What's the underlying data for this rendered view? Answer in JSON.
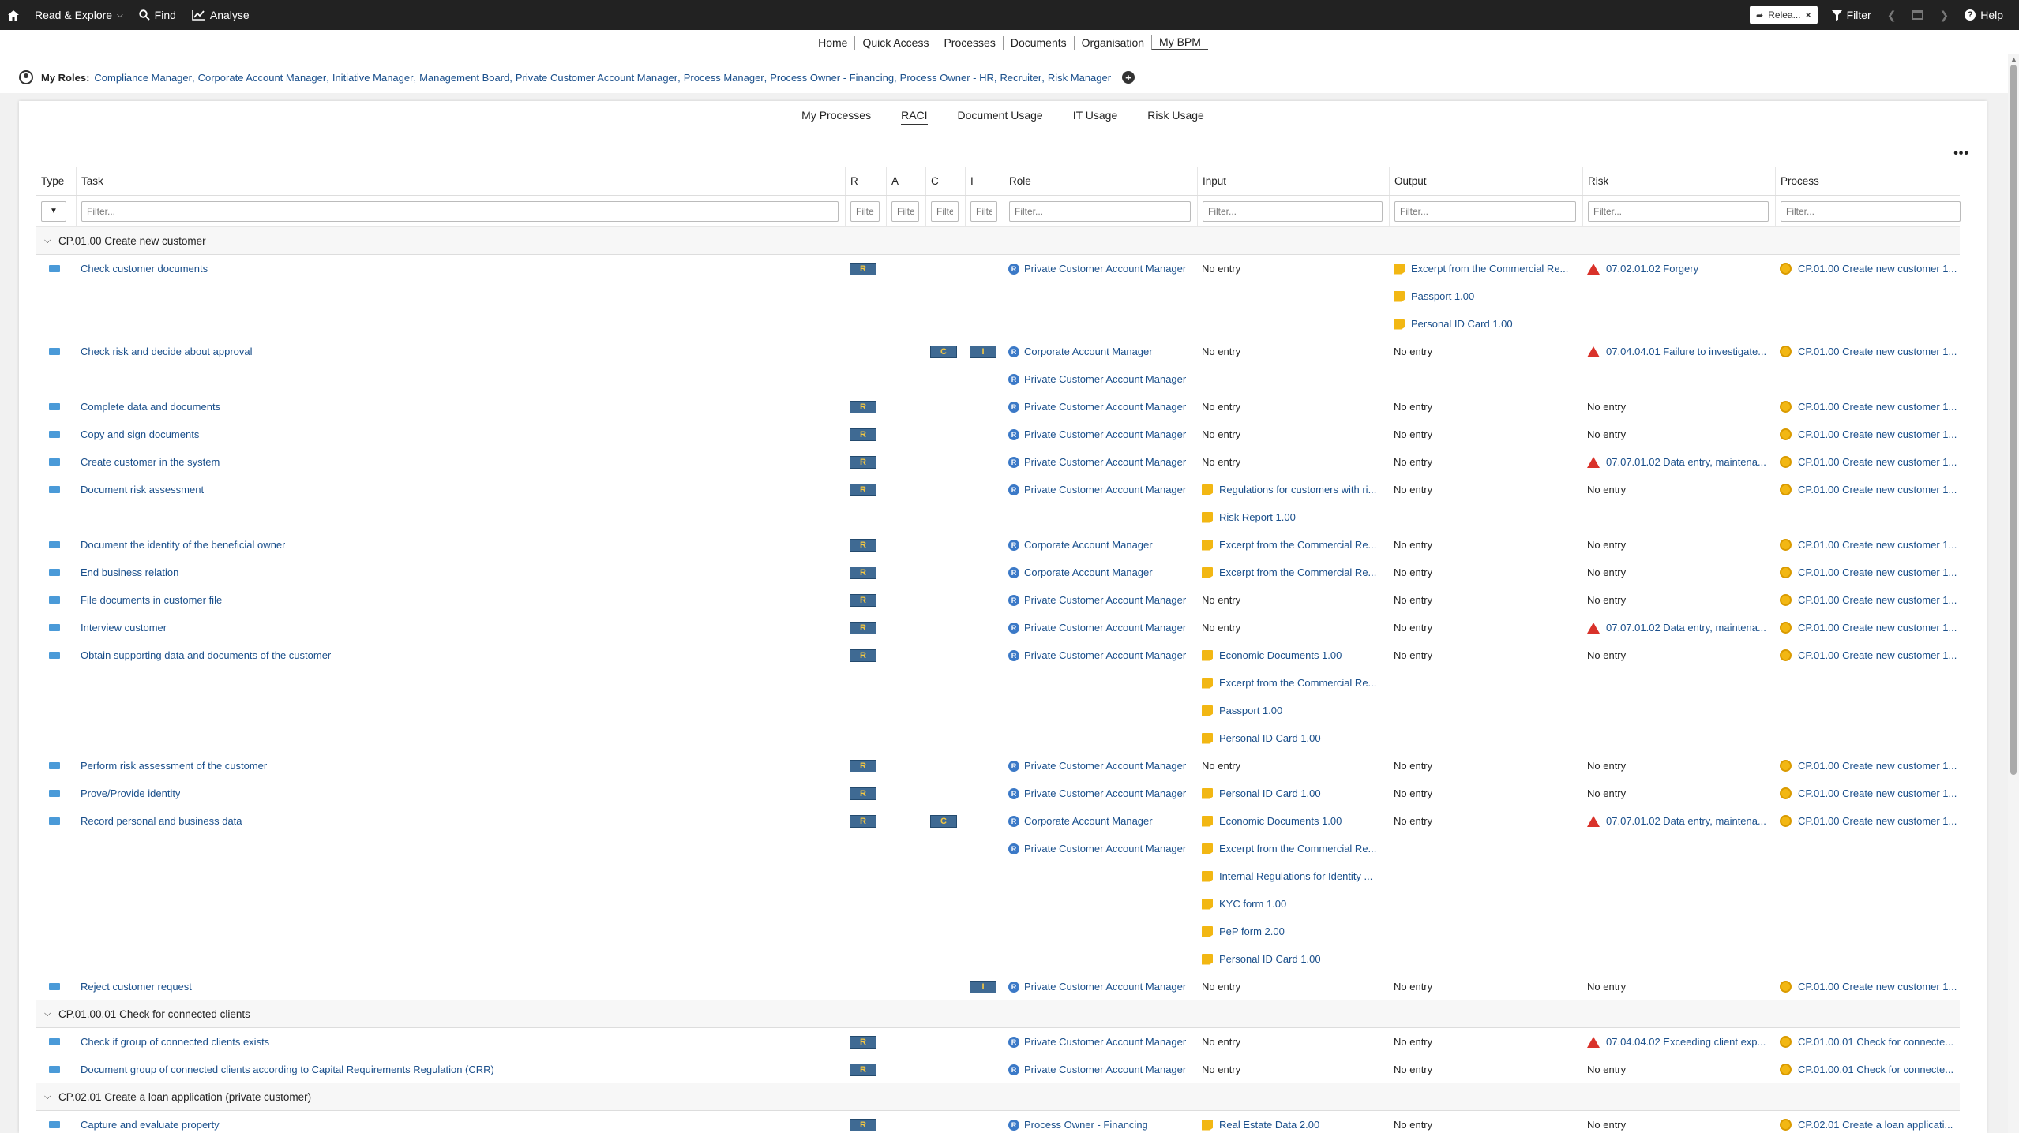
{
  "topbar": {
    "read_explore": "Read & Explore",
    "find": "Find",
    "analyse": "Analyse",
    "release_chip": "Relea...",
    "filter": "Filter",
    "help": "Help"
  },
  "nav": [
    "Home",
    "Quick Access",
    "Processes",
    "Documents",
    "Organisation",
    "My BPM"
  ],
  "roles": {
    "label": "My Roles:",
    "items": [
      "Compliance Manager",
      "Corporate Account Manager",
      "Initiative Manager",
      "Management Board",
      "Private Customer Account Manager",
      "Process Manager",
      "Process Owner - Financing",
      "Process Owner - HR",
      "Recruiter",
      "Risk Manager"
    ]
  },
  "tabs": [
    "My Processes",
    "RACI",
    "Document Usage",
    "IT Usage",
    "Risk Usage"
  ],
  "columns": [
    "Type",
    "Task",
    "R",
    "A",
    "C",
    "I",
    "Role",
    "Input",
    "Output",
    "Risk",
    "Process"
  ],
  "filters": {
    "text": "Filter...",
    "short": "Filte"
  },
  "no_entry": "No entry",
  "rows": [
    {
      "kind": "group",
      "label": "CP.01.00 Create new customer"
    },
    {
      "kind": "task",
      "task": "Check customer documents",
      "r": "R",
      "a": "",
      "c": "",
      "i": "",
      "roles": [
        "Private Customer Account Manager"
      ],
      "input": [],
      "output": [
        "Excerpt from the Commercial Re...",
        "Passport 1.00",
        "Personal ID Card 1.00"
      ],
      "risk": [
        "07.02.01.02 Forgery"
      ],
      "process": "CP.01.00 Create new customer 1..."
    },
    {
      "kind": "task",
      "task": "Check risk and decide about approval",
      "r": "",
      "a": "",
      "c": "C",
      "i": "I",
      "roles": [
        "Corporate Account Manager",
        "Private Customer Account Manager"
      ],
      "input": [],
      "output": [],
      "risk": [
        "07.04.04.01 Failure to investigate..."
      ],
      "process": "CP.01.00 Create new customer 1..."
    },
    {
      "kind": "task",
      "task": "Complete data and documents",
      "r": "R",
      "a": "",
      "c": "",
      "i": "",
      "roles": [
        "Private Customer Account Manager"
      ],
      "input": [],
      "output": [],
      "risk": [],
      "process": "CP.01.00 Create new customer 1..."
    },
    {
      "kind": "task",
      "task": "Copy and sign documents",
      "r": "R",
      "a": "",
      "c": "",
      "i": "",
      "roles": [
        "Private Customer Account Manager"
      ],
      "input": [],
      "output": [],
      "risk": [],
      "process": "CP.01.00 Create new customer 1..."
    },
    {
      "kind": "task",
      "task": "Create customer in the system",
      "r": "R",
      "a": "",
      "c": "",
      "i": "",
      "roles": [
        "Private Customer Account Manager"
      ],
      "input": [],
      "output": [],
      "risk": [
        "07.07.01.02 Data entry, maintena..."
      ],
      "process": "CP.01.00 Create new customer 1..."
    },
    {
      "kind": "task",
      "task": "Document risk assessment",
      "r": "R",
      "a": "",
      "c": "",
      "i": "",
      "roles": [
        "Private Customer Account Manager"
      ],
      "input": [
        "Regulations for customers with ri...",
        "Risk Report 1.00"
      ],
      "output": [],
      "risk": [],
      "process": "CP.01.00 Create new customer 1..."
    },
    {
      "kind": "task",
      "task": "Document the identity of the beneficial owner",
      "r": "R",
      "a": "",
      "c": "",
      "i": "",
      "roles": [
        "Corporate Account Manager"
      ],
      "input": [
        "Excerpt from the Commercial Re..."
      ],
      "output": [],
      "risk": [],
      "process": "CP.01.00 Create new customer 1..."
    },
    {
      "kind": "task",
      "task": "End business relation",
      "r": "R",
      "a": "",
      "c": "",
      "i": "",
      "roles": [
        "Corporate Account Manager"
      ],
      "input": [
        "Excerpt from the Commercial Re..."
      ],
      "output": [],
      "risk": [],
      "process": "CP.01.00 Create new customer 1..."
    },
    {
      "kind": "task",
      "task": "File documents in customer file",
      "r": "R",
      "a": "",
      "c": "",
      "i": "",
      "roles": [
        "Private Customer Account Manager"
      ],
      "input": [],
      "output": [],
      "risk": [],
      "process": "CP.01.00 Create new customer 1..."
    },
    {
      "kind": "task",
      "task": "Interview customer",
      "r": "R",
      "a": "",
      "c": "",
      "i": "",
      "roles": [
        "Private Customer Account Manager"
      ],
      "input": [],
      "output": [],
      "risk": [
        "07.07.01.02 Data entry, maintena..."
      ],
      "process": "CP.01.00 Create new customer 1..."
    },
    {
      "kind": "task",
      "task": "Obtain supporting data and documents of the customer",
      "r": "R",
      "a": "",
      "c": "",
      "i": "",
      "roles": [
        "Private Customer Account Manager"
      ],
      "input": [
        "Economic Documents 1.00",
        "Excerpt from the Commercial Re...",
        "Passport 1.00",
        "Personal ID Card 1.00"
      ],
      "output": [],
      "risk": [],
      "process": "CP.01.00 Create new customer 1..."
    },
    {
      "kind": "task",
      "task": "Perform risk assessment of the customer",
      "r": "R",
      "a": "",
      "c": "",
      "i": "",
      "roles": [
        "Private Customer Account Manager"
      ],
      "input": [],
      "output": [],
      "risk": [],
      "process": "CP.01.00 Create new customer 1..."
    },
    {
      "kind": "task",
      "task": "Prove/Provide identity",
      "r": "R",
      "a": "",
      "c": "",
      "i": "",
      "roles": [
        "Private Customer Account Manager"
      ],
      "input": [
        "Personal ID Card 1.00"
      ],
      "output": [],
      "risk": [],
      "process": "CP.01.00 Create new customer 1..."
    },
    {
      "kind": "task",
      "task": "Record personal and business data",
      "r": "R",
      "a": "",
      "c": "C",
      "i": "",
      "roles": [
        "Corporate Account Manager",
        "Private Customer Account Manager"
      ],
      "input": [
        "Economic Documents 1.00",
        "Excerpt from the Commercial Re...",
        "Internal Regulations for Identity ...",
        "KYC form 1.00",
        "PeP form 2.00",
        "Personal ID Card 1.00"
      ],
      "output": [],
      "risk": [
        "07.07.01.02 Data entry, maintena..."
      ],
      "process": "CP.01.00 Create new customer 1..."
    },
    {
      "kind": "task",
      "task": "Reject customer request",
      "r": "",
      "a": "",
      "c": "",
      "i": "I",
      "roles": [
        "Private Customer Account Manager"
      ],
      "input": [],
      "output": [],
      "risk": [],
      "process": "CP.01.00 Create new customer 1..."
    },
    {
      "kind": "group",
      "label": "CP.01.00.01 Check for connected clients"
    },
    {
      "kind": "task",
      "task": "Check if group of connected clients exists",
      "r": "R",
      "a": "",
      "c": "",
      "i": "",
      "roles": [
        "Private Customer Account Manager"
      ],
      "input": [],
      "output": [],
      "risk": [
        "07.04.04.02 Exceeding client exp..."
      ],
      "process": "CP.01.00.01 Check for connecte..."
    },
    {
      "kind": "task",
      "task": "Document group of connected clients according to Capital Requirements Regulation (CRR)",
      "r": "R",
      "a": "",
      "c": "",
      "i": "",
      "roles": [
        "Private Customer Account Manager"
      ],
      "input": [],
      "output": [],
      "risk": [],
      "process": "CP.01.00.01 Check for connecte..."
    },
    {
      "kind": "group",
      "label": "CP.02.01 Create a loan application (private customer)"
    },
    {
      "kind": "task",
      "task": "Capture and evaluate property",
      "r": "R",
      "a": "",
      "c": "",
      "i": "",
      "roles": [
        "Process Owner - Financing"
      ],
      "input": [
        "Real Estate Data 2.00"
      ],
      "output": [],
      "risk": [],
      "process": "CP.02.01 Create a loan applicati..."
    }
  ]
}
